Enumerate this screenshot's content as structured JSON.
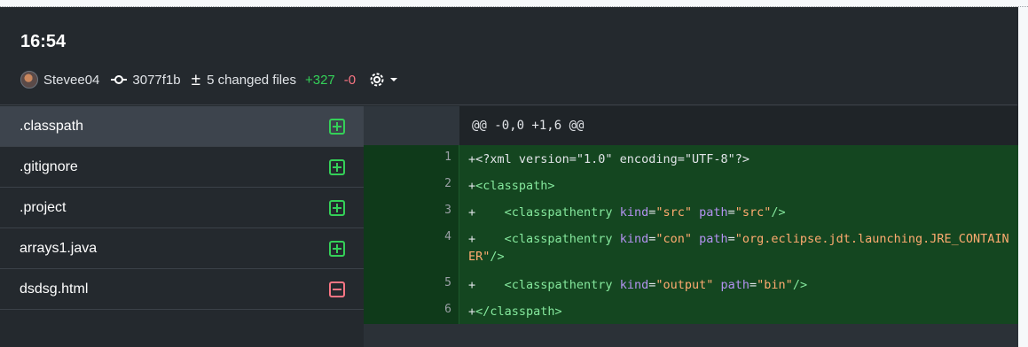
{
  "commit": {
    "time": "16:54",
    "author": "Stevee04",
    "sha": "3077f1b",
    "changed_files": "5 changed files",
    "additions": "+327",
    "deletions": "-0"
  },
  "files": [
    {
      "name": ".classpath",
      "status": "added"
    },
    {
      "name": ".gitignore",
      "status": "added"
    },
    {
      "name": ".project",
      "status": "added"
    },
    {
      "name": "arrays1.java",
      "status": "added"
    },
    {
      "name": "dsdsg.html",
      "status": "removed"
    }
  ],
  "diff": {
    "hunk": "@@ -0,0 +1,6 @@",
    "lines": [
      {
        "num": "1",
        "parts": [
          [
            "plain",
            "+<?xml version=\"1.0\" encoding=\"UTF-8\"?>"
          ]
        ]
      },
      {
        "num": "2",
        "parts": [
          [
            "plain",
            "+"
          ],
          [
            "tag",
            "<classpath>"
          ]
        ]
      },
      {
        "num": "3",
        "parts": [
          [
            "plain",
            "+    "
          ],
          [
            "tag",
            "<classpathentry "
          ],
          [
            "attr",
            "kind"
          ],
          [
            "plain",
            "="
          ],
          [
            "str",
            "\"src\""
          ],
          [
            "plain",
            " "
          ],
          [
            "attr",
            "path"
          ],
          [
            "plain",
            "="
          ],
          [
            "str",
            "\"src\""
          ],
          [
            "tag",
            "/>"
          ]
        ]
      },
      {
        "num": "4",
        "parts": [
          [
            "plain",
            "+    "
          ],
          [
            "tag",
            "<classpathentry "
          ],
          [
            "attr",
            "kind"
          ],
          [
            "plain",
            "="
          ],
          [
            "str",
            "\"con\""
          ],
          [
            "plain",
            " "
          ],
          [
            "attr",
            "path"
          ],
          [
            "plain",
            "="
          ],
          [
            "str",
            "\"org.eclipse.jdt.launching.JRE_CONTAINER\""
          ],
          [
            "tag",
            "/>"
          ]
        ]
      },
      {
        "num": "5",
        "parts": [
          [
            "plain",
            "+    "
          ],
          [
            "tag",
            "<classpathentry "
          ],
          [
            "attr",
            "kind"
          ],
          [
            "plain",
            "="
          ],
          [
            "str",
            "\"output\""
          ],
          [
            "plain",
            " "
          ],
          [
            "attr",
            "path"
          ],
          [
            "plain",
            "="
          ],
          [
            "str",
            "\"bin\""
          ],
          [
            "tag",
            "/>"
          ]
        ]
      },
      {
        "num": "6",
        "parts": [
          [
            "plain",
            "+"
          ],
          [
            "tag",
            "</classpath>"
          ]
        ]
      }
    ]
  },
  "colors": {
    "addition": "#34d058",
    "deletion": "#f97583",
    "added_line_bg": "#144620"
  },
  "icons": {
    "commit": "git-commit-icon",
    "diff": "plus-minus-icon",
    "settings": "gear-icon",
    "dropdown": "caret-down-icon"
  }
}
